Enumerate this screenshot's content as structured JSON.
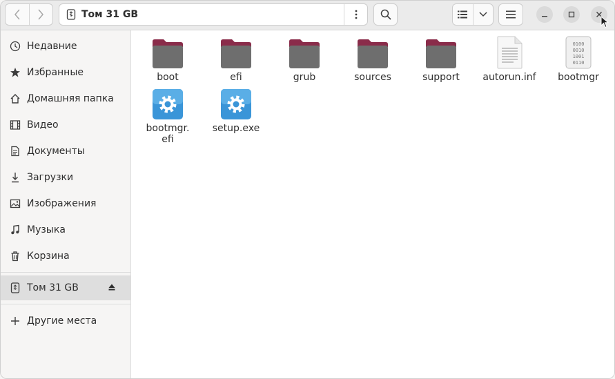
{
  "header": {
    "path_label": "Том 31 GB",
    "icons": {
      "back": "chevron-left-icon",
      "forward": "chevron-right-icon",
      "usb": "usb-drive-icon",
      "path_menu": "vertical-dots-icon",
      "search": "search-icon",
      "list_view": "list-view-icon",
      "view_options": "chevron-down-icon",
      "main_menu": "hamburger-menu-icon",
      "minimize": "minimize-icon",
      "maximize": "maximize-icon",
      "close": "close-icon"
    }
  },
  "sidebar": {
    "items": [
      {
        "label": "Недавние",
        "icon": "clock-icon"
      },
      {
        "label": "Избранные",
        "icon": "star-icon"
      },
      {
        "label": "Домашняя папка",
        "icon": "home-icon"
      },
      {
        "label": "Видео",
        "icon": "film-icon"
      },
      {
        "label": "Документы",
        "icon": "document-icon"
      },
      {
        "label": "Загрузки",
        "icon": "download-icon"
      },
      {
        "label": "Изображения",
        "icon": "image-icon"
      },
      {
        "label": "Музыка",
        "icon": "music-icon"
      },
      {
        "label": "Корзина",
        "icon": "trash-icon"
      }
    ],
    "device": {
      "label": "Том 31 GB",
      "icon": "usb-drive-icon",
      "eject_icon": "eject-icon"
    },
    "other": {
      "label": "Другие места",
      "icon": "plus-icon"
    }
  },
  "files": [
    {
      "name": "boot",
      "type": "folder"
    },
    {
      "name": "efi",
      "type": "folder"
    },
    {
      "name": "grub",
      "type": "folder"
    },
    {
      "name": "sources",
      "type": "folder"
    },
    {
      "name": "support",
      "type": "folder"
    },
    {
      "name": "autorun.inf",
      "type": "text-file"
    },
    {
      "name": "bootmgr",
      "type": "binary-file"
    },
    {
      "name": "bootmgr.\nefi",
      "type": "executable"
    },
    {
      "name": "setup.exe",
      "type": "executable"
    }
  ],
  "colors": {
    "folder_body": "#6e6e6e",
    "folder_tab": "#8a2c4a",
    "exec_bg": "#3a95d8",
    "selected": "#dedede"
  }
}
